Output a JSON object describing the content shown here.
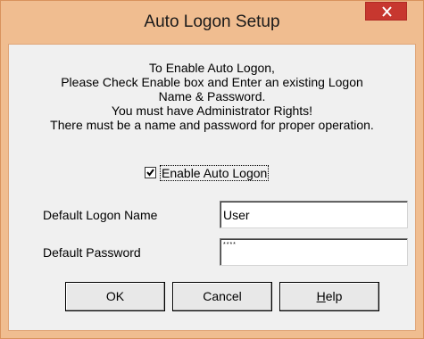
{
  "window": {
    "title": "Auto Logon Setup"
  },
  "message": {
    "lines": [
      "To Enable Auto Logon,",
      "Please Check Enable box and Enter an existing Logon",
      "Name & Password.",
      "You must have Administrator Rights!",
      "There must be a name and password for proper operation."
    ]
  },
  "enable_checkbox": {
    "label": "Enable Auto Logon",
    "checked": true
  },
  "logon_name": {
    "label": "Default Logon Name",
    "value": "User"
  },
  "password": {
    "label": "Default Password",
    "masked_value": "****"
  },
  "buttons": {
    "ok": "OK",
    "cancel": "Cancel",
    "help": "Help"
  },
  "icons": {
    "close": "close-icon",
    "check": "checkmark-icon"
  },
  "colors": {
    "title_bar": "#f0bd90",
    "close_button": "#c7372f",
    "client_background": "#f0f0f0"
  }
}
